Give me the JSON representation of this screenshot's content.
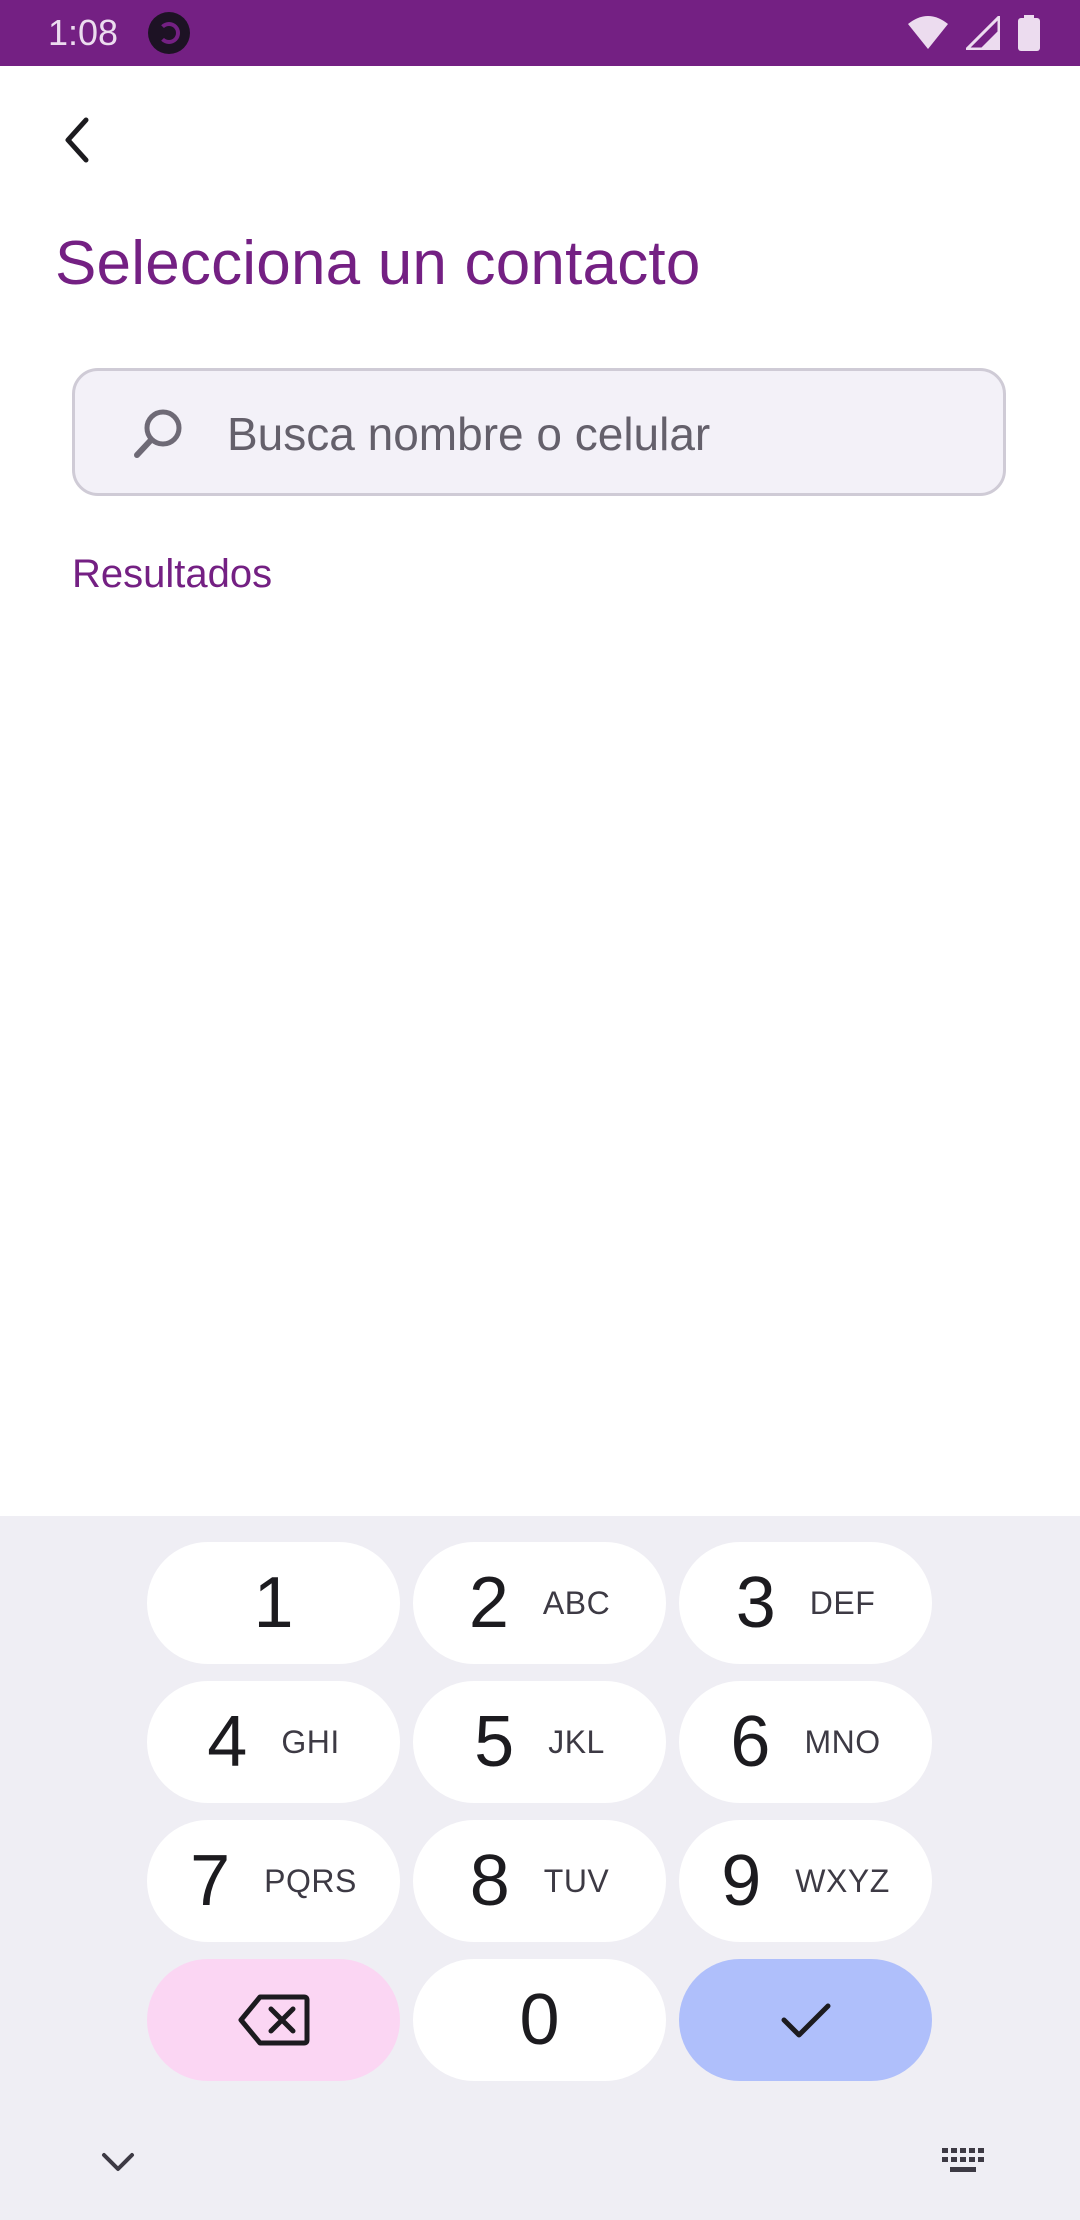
{
  "status_bar": {
    "time": "1:08",
    "icons": [
      "app-notification-icon",
      "wifi-icon",
      "signal-icon",
      "battery-icon"
    ],
    "background_color": "#742083"
  },
  "app_bar": {
    "back_icon": "chevron-left-icon"
  },
  "page": {
    "title": "Selecciona un contacto",
    "accent_color": "#742083"
  },
  "search": {
    "placeholder": "Busca nombre o celular",
    "value": "",
    "icon": "search-icon"
  },
  "results": {
    "label": "Resultados",
    "items": []
  },
  "keyboard": {
    "keys": [
      {
        "digit": "1",
        "letters": ""
      },
      {
        "digit": "2",
        "letters": "ABC"
      },
      {
        "digit": "3",
        "letters": "DEF"
      },
      {
        "digit": "4",
        "letters": "GHI"
      },
      {
        "digit": "5",
        "letters": "JKL"
      },
      {
        "digit": "6",
        "letters": "MNO"
      },
      {
        "digit": "7",
        "letters": "PQRS"
      },
      {
        "digit": "8",
        "letters": "TUV"
      },
      {
        "digit": "9",
        "letters": "WXYZ"
      },
      {
        "digit": "0",
        "letters": ""
      }
    ],
    "delete_icon": "backspace-icon",
    "confirm_icon": "checkmark-icon",
    "hide_icon": "chevron-down-icon",
    "switch_icon": "keyboard-icon",
    "delete_color": "#fbd6f3",
    "confirm_color": "#afbffb"
  }
}
